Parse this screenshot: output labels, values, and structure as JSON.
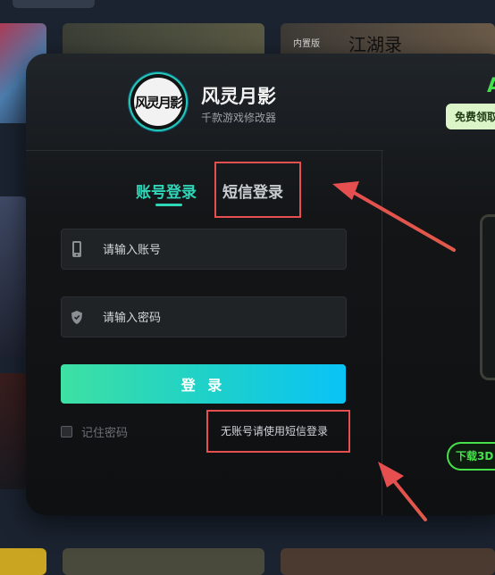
{
  "background": {
    "tag": "内置版",
    "game_title": "江湖录"
  },
  "app": {
    "logo_text": "风灵月影",
    "name": "风灵月影",
    "subtitle": "千款游戏修改器"
  },
  "tabs": {
    "account": "账号登录",
    "sms": "短信登录"
  },
  "fields": {
    "account_placeholder": "请输入账号",
    "password_placeholder": "请输入密码"
  },
  "login_button": "登 录",
  "remember_label": "记住密码",
  "sms_link": "无账号请使用短信登录",
  "right_panel": {
    "letter": "A",
    "promo": "免费领取",
    "download": "下载3D"
  },
  "colors": {
    "accent": "#2fd6b8",
    "annotation": "#e54f4f",
    "green": "#46e04a"
  }
}
